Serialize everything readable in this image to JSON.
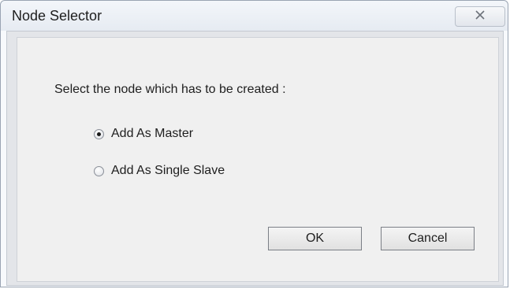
{
  "window": {
    "title": "Node Selector",
    "close_icon": "close-icon"
  },
  "dialog": {
    "prompt": "Select the node which has to be created :",
    "options": [
      {
        "label": "Add As Master",
        "selected": true
      },
      {
        "label": "Add As Single Slave",
        "selected": false
      }
    ]
  },
  "buttons": {
    "ok_label": "OK",
    "cancel_label": "Cancel"
  },
  "colors": {
    "title_bar": "#e6ebf2",
    "dialog_bg": "#f0f0f0",
    "text": "#1e1e1e"
  }
}
